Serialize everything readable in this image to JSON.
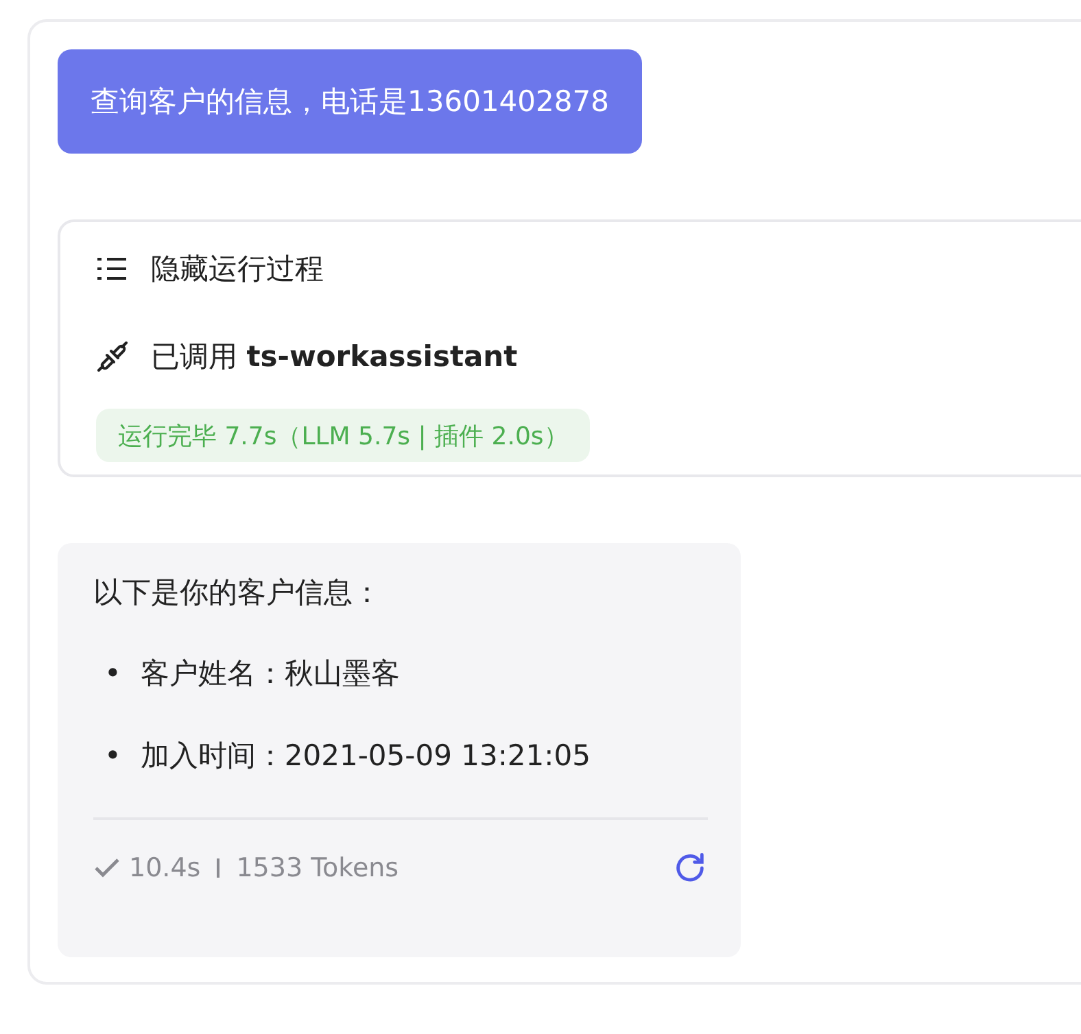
{
  "user_message": "查询客户的信息，电话是13601402878",
  "process": {
    "toggle_label": "隐藏运行过程",
    "plugin_call": "已调用 **ts-workassistant**",
    "status": "运行完毕 7.7s（LLM 5.7s | 插件 2.0s）"
  },
  "answer": {
    "intro": "以下是你的客户信息：",
    "items": [
      {
        "bullet": "•",
        "text": "客户姓名：秋山墨客"
      },
      {
        "bullet": "•",
        "text": "加入时间：2021-05-09 13:21:05"
      }
    ],
    "footer": {
      "duration": "10.4s",
      "tokens": "1533 Tokens"
    }
  }
}
